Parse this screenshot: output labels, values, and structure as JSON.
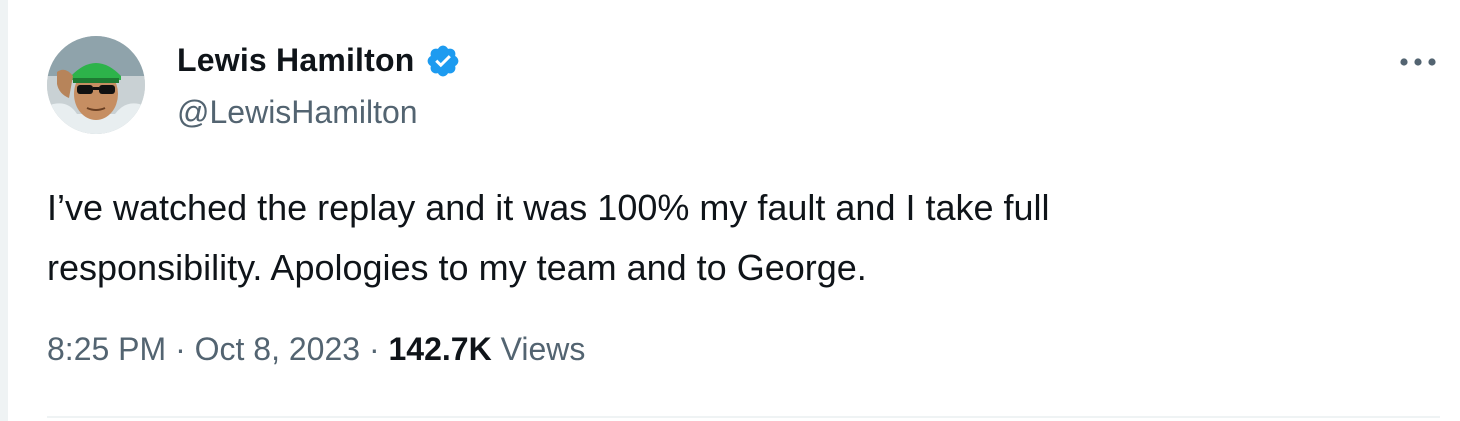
{
  "author": {
    "display_name": "Lewis Hamilton",
    "handle": "@LewisHamilton",
    "verified": true,
    "avatar_icon": "profile-photo"
  },
  "tweet": {
    "text_line1": "I’ve watched the replay and it was 100% my fault and I take full",
    "text_line2": "responsibility. Apologies to my team and to George."
  },
  "meta": {
    "time": "8:25 PM",
    "separator": " · ",
    "date": "Oct 8, 2023",
    "views_count": "142.7K",
    "views_label": "Views"
  },
  "icons": {
    "more": "more-horizontal-icon",
    "verified": "verified-badge-icon"
  },
  "colors": {
    "verified_blue": "#1d9bf0",
    "secondary_text": "#536471",
    "primary_text": "#0f1419",
    "divider": "#eff3f4"
  }
}
